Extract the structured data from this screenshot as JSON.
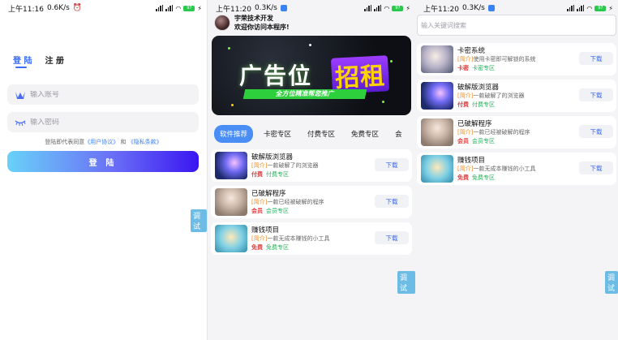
{
  "status_p1": {
    "time": "上午11:16",
    "net": "0.6K/s",
    "batt": "97"
  },
  "status_p2": {
    "time": "上午11:20",
    "net": "0.3K/s",
    "batt": "97"
  },
  "status_p3": {
    "time": "上午11:20",
    "net": "0.3K/s",
    "batt": "97"
  },
  "login": {
    "tab_login": "登 陆",
    "tab_register": "注 册",
    "account_placeholder": "输入账号",
    "password_placeholder": "输入密码",
    "agree_prefix": "登陆即代表同意",
    "user_agreement": "《用户协议》",
    "agree_and": "和",
    "privacy_policy": "《隐私条款》",
    "login_button": "登 陆",
    "debug": "调试"
  },
  "home": {
    "user_name": "宇荣技术开发",
    "welcome": "欢迎你访问本程序!",
    "banner": {
      "title": "广告位",
      "highlight": "招租",
      "strip": "全方位精准帮您推广"
    },
    "tabs": [
      "软件推荐",
      "卡密专区",
      "付费专区",
      "免费专区",
      "会"
    ],
    "debug": "调试",
    "items": [
      {
        "name": "破解版浏览器",
        "tag": "[简介]",
        "desc": "一款破解了的浏览器",
        "price": "付费",
        "zone": "付费专区",
        "download": "下载"
      },
      {
        "name": "已破解程序",
        "tag": "[简介]",
        "desc": "一款已经被破解的程序",
        "price": "会员",
        "zone": "会员专区",
        "download": "下载"
      },
      {
        "name": "赚钱项目",
        "tag": "[简介]",
        "desc": "一款无成本赚钱的小工具",
        "price": "免费",
        "zone": "免费专区",
        "download": "下载"
      }
    ]
  },
  "search_page": {
    "placeholder": "输入关键词搜索",
    "debug": "调试",
    "items": [
      {
        "name": "卡密系统",
        "tag": "[简介]",
        "desc": "使用卡密即可解锁的系统",
        "price": "卡密",
        "zone": "卡密专区",
        "download": "下载"
      },
      {
        "name": "破解版浏览器",
        "tag": "[简介]",
        "desc": "一款破解了的浏览器",
        "price": "付费",
        "zone": "付费专区",
        "download": "下载"
      },
      {
        "name": "已破解程序",
        "tag": "[简介]",
        "desc": "一款已经被破解的程序",
        "price": "会员",
        "zone": "会员专区",
        "download": "下载"
      },
      {
        "name": "赚钱项目",
        "tag": "[简介]",
        "desc": "一款无成本赚钱的小工具",
        "price": "免费",
        "zone": "免费专区",
        "download": "下载"
      }
    ]
  },
  "colors": {
    "accent": "#3b6cf6",
    "price": "#e03c3c",
    "zone": "#23b25a",
    "tag": "#f08a24"
  },
  "icons": {
    "account": "crown-logo-icon",
    "password": "eye-lashes-icon",
    "wifi": "wifi-icon",
    "alarm": "alarm-clock-icon"
  }
}
